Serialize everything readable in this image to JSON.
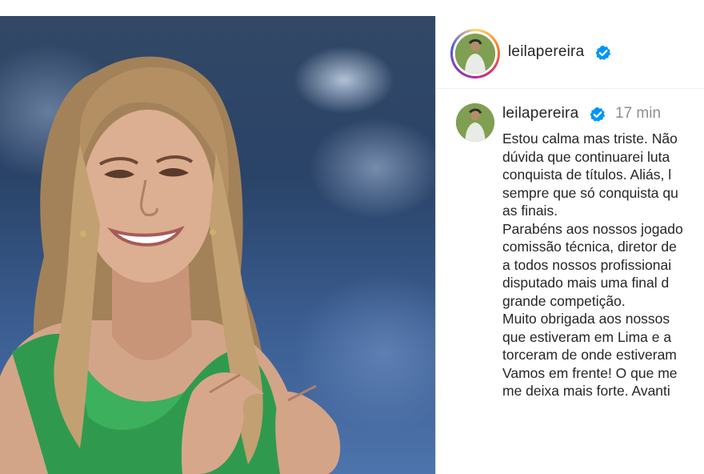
{
  "post": {
    "author": "leilapereira",
    "timestamp": "17 min",
    "caption_lines": [
      "Estou calma mas triste. Não",
      "dúvida que continuarei luta",
      "conquista de títulos. Aliás, l",
      "sempre que só conquista qu",
      "as finais.",
      "Parabéns aos nossos jogado",
      "comissão técnica, diretor de",
      "a todos nossos profissionai",
      "disputado mais uma final d",
      "grande competição.",
      "Muito obrigada aos nossos",
      "que estiveram em Lima e a",
      "torceram de onde estiveram",
      "Vamos em frente! O que me",
      "me deixa mais forte. Avanti"
    ]
  },
  "icons": {
    "verified": "verified-badge-icon",
    "verified_color": "#0095f6"
  },
  "colors": {
    "border": "#dbdbdb",
    "text": "#262626",
    "muted": "#8e8e8e"
  }
}
